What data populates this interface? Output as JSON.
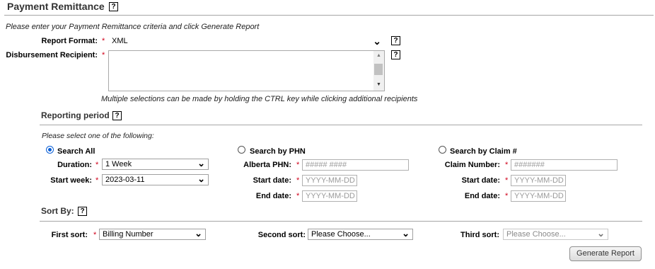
{
  "header": {
    "title": "Payment Remittance",
    "help": "?"
  },
  "intro": "Please enter your Payment Remittance criteria and click Generate Report",
  "report_format": {
    "label": "Report Format:",
    "required": "*",
    "value": "XML",
    "help": "?"
  },
  "disbursement": {
    "label": "Disbursement Recipient:",
    "required": "*",
    "help": "?",
    "hint": "Multiple selections can be made by holding the CTRL key while clicking additional recipients"
  },
  "reporting_period": {
    "title": "Reporting period",
    "help": "?",
    "instruction": "Please select one of the following:",
    "search_all": {
      "label": "Search All",
      "selected": true,
      "duration_label": "Duration:",
      "duration_value": "1 Week",
      "start_week_label": "Start week:",
      "start_week_value": "2023-03-11"
    },
    "search_phn": {
      "label": "Search by PHN",
      "selected": false,
      "phn_label": "Alberta PHN:",
      "phn_placeholder": "##### ####",
      "start_label": "Start date:",
      "start_placeholder": "YYYY-MM-DD",
      "end_label": "End date:",
      "end_placeholder": "YYYY-MM-DD"
    },
    "search_claim": {
      "label": "Search by Claim #",
      "selected": false,
      "claim_label": "Claim Number:",
      "claim_placeholder": "#######",
      "start_label": "Start date:",
      "start_placeholder": "YYYY-MM-DD",
      "end_label": "End date:",
      "end_placeholder": "YYYY-MM-DD"
    },
    "required": "*"
  },
  "sort_by": {
    "title": "Sort By:",
    "help": "?",
    "first_label": "First sort:",
    "first_value": "Billing Number",
    "second_label": "Second sort:",
    "second_value": "Please Choose...",
    "third_label": "Third sort:",
    "third_value": "Please Choose...",
    "required": "*"
  },
  "actions": {
    "generate": "Generate Report"
  },
  "icons": {
    "dropdown": "chevron-down-icon",
    "help": "help-icon",
    "scroll_up": "arrow-up-icon",
    "scroll_down": "arrow-down-icon"
  },
  "colors": {
    "required": "#d0021b",
    "radio_selected": "#0a5fd6",
    "rule": "#a6a6a6"
  }
}
